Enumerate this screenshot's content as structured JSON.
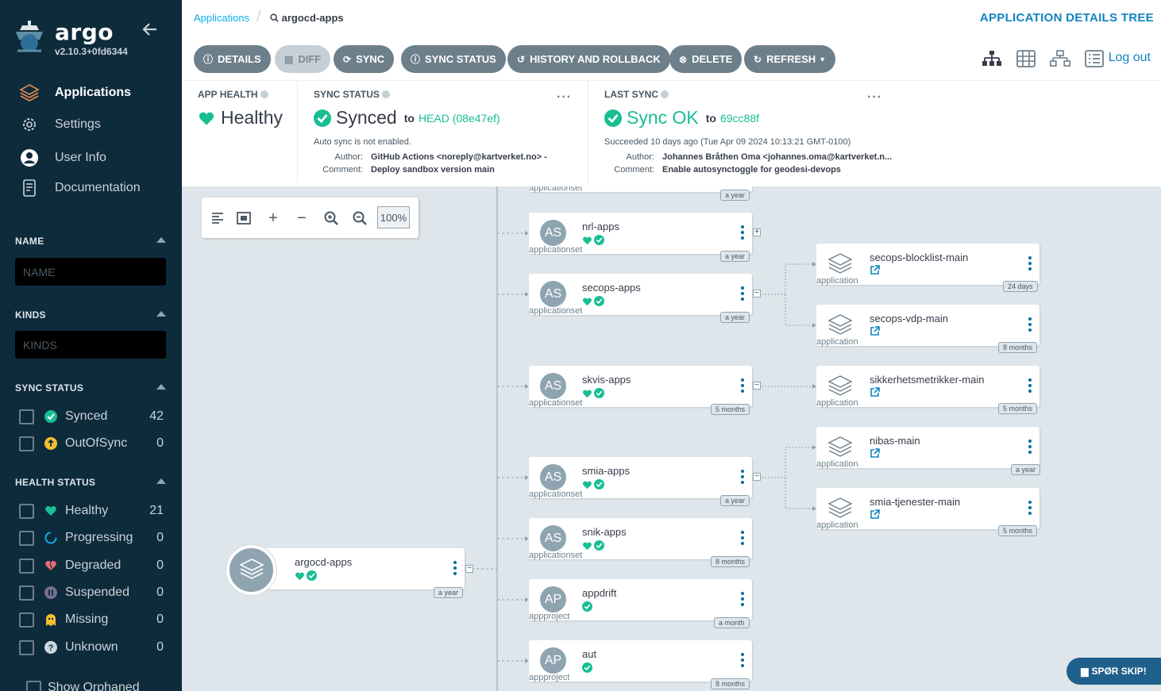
{
  "sidebar": {
    "brand": "argo",
    "version": "v2.10.3+0fd6344",
    "nav": [
      {
        "label": "Applications",
        "icon": "layers-icon",
        "active": true
      },
      {
        "label": "Settings",
        "icon": "gear-icon",
        "active": false
      },
      {
        "label": "User Info",
        "icon": "user-icon",
        "active": false
      },
      {
        "label": "Documentation",
        "icon": "book-icon",
        "active": false
      }
    ],
    "filters": {
      "name": {
        "title": "NAME",
        "placeholder": "NAME"
      },
      "kinds": {
        "title": "KINDS",
        "placeholder": "KINDS"
      },
      "sync_status": {
        "title": "SYNC STATUS",
        "items": [
          {
            "label": "Synced",
            "count": "42",
            "icon": "synced-icon"
          },
          {
            "label": "OutOfSync",
            "count": "0",
            "icon": "out-of-sync-icon"
          }
        ]
      },
      "health_status": {
        "title": "HEALTH STATUS",
        "items": [
          {
            "label": "Healthy",
            "count": "21",
            "icon": "heart-icon"
          },
          {
            "label": "Progressing",
            "count": "0",
            "icon": "progressing-icon"
          },
          {
            "label": "Degraded",
            "count": "0",
            "icon": "broken-heart-icon"
          },
          {
            "label": "Suspended",
            "count": "0",
            "icon": "pause-icon"
          },
          {
            "label": "Missing",
            "count": "0",
            "icon": "ghost-icon"
          },
          {
            "label": "Unknown",
            "count": "0",
            "icon": "question-icon"
          }
        ]
      },
      "show_orphaned": "Show Orphaned"
    }
  },
  "header": {
    "breadcrumb_root": "Applications",
    "breadcrumb_current": "argocd-apps",
    "page_kind": "APPLICATION DETAILS TREE"
  },
  "toolbar": {
    "details": "DETAILS",
    "diff": "DIFF",
    "sync": "SYNC",
    "sync_status": "SYNC STATUS",
    "history": "HISTORY AND ROLLBACK",
    "delete": "DELETE",
    "refresh": "REFRESH",
    "logout": "Log out"
  },
  "status": {
    "app_health": {
      "title": "APP HEALTH",
      "value": "Healthy"
    },
    "sync_status": {
      "title": "SYNC STATUS",
      "value": "Synced",
      "to": "to",
      "revision": "HEAD (08e47ef)",
      "auto_sync": "Auto sync is not enabled.",
      "author_key": "Author:",
      "author": "GitHub Actions <noreply@kartverket.no> -",
      "comment_key": "Comment:",
      "comment": "Deploy sandbox version main"
    },
    "last_sync": {
      "title": "LAST SYNC",
      "value": "Sync OK",
      "to": "to",
      "revision": "69cc88f",
      "succeeded": "Succeeded 10 days ago (Tue Apr 09 2024 10:13:21 GMT-0100)",
      "author_key": "Author:",
      "author": "Johannes Bråthen Oma <johannes.oma@kartverket.n...",
      "comment_key": "Comment:",
      "comment": "Enable autosynctoggle for geodesi-devops"
    }
  },
  "graph": {
    "zoom": "100%",
    "root": {
      "name": "argocd-apps",
      "age": "a year"
    },
    "top_partial": {
      "kind": "applicationset",
      "age": "a year"
    },
    "children": [
      {
        "abbr": "AS",
        "name": "nrl-apps",
        "kind": "applicationset",
        "age": "a year",
        "toggle": "+"
      },
      {
        "abbr": "AS",
        "name": "secops-apps",
        "kind": "applicationset",
        "age": "a year",
        "toggle": "−"
      },
      {
        "abbr": "AS",
        "name": "skvis-apps",
        "kind": "applicationset",
        "age": "5 months",
        "toggle": "−"
      },
      {
        "abbr": "AS",
        "name": "smia-apps",
        "kind": "applicationset",
        "age": "a year",
        "toggle": "−"
      },
      {
        "abbr": "AS",
        "name": "snik-apps",
        "kind": "applicationset",
        "age": "8 months",
        "toggle": ""
      },
      {
        "abbr": "AP",
        "name": "appdrift",
        "kind": "appproject",
        "age": "a month",
        "toggle": ""
      },
      {
        "abbr": "AP",
        "name": "aut",
        "kind": "appproject",
        "age": "8 months",
        "toggle": ""
      }
    ],
    "apps": [
      {
        "name": "secops-blocklist-main",
        "kind": "application",
        "age": "24 days"
      },
      {
        "name": "secops-vdp-main",
        "kind": "application",
        "age": "8 months"
      },
      {
        "name": "sikkerhetsmetrikker-main",
        "kind": "application",
        "age": "5 months"
      },
      {
        "name": "nibas-main",
        "kind": "application",
        "age": "a year"
      },
      {
        "name": "smia-tjenester-main",
        "kind": "application",
        "age": "5 months"
      }
    ]
  },
  "chat": "SPØR SKIP!",
  "colors": {
    "sidebar": "#0e2b3b",
    "healthy": "#18be94",
    "accent": "#1185bf",
    "button": "#6d7f8b"
  }
}
